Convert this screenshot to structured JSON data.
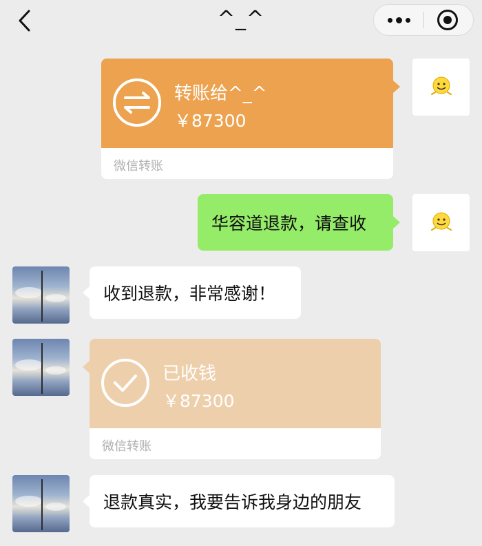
{
  "header": {
    "title": "^_^"
  },
  "colors": {
    "background": "#ececec",
    "transfer_sent": "#eda24f",
    "transfer_received": "#eecfac",
    "bubble_self": "#95ec69",
    "bubble_friend": "#ffffff"
  },
  "messages": [
    {
      "type": "transfer",
      "direction": "sent",
      "title": "转账给^_^",
      "amount": "￥87300",
      "footer": "微信转账",
      "icon": "transfer-arrows-icon"
    },
    {
      "type": "text",
      "direction": "sent",
      "text": "华容道退款，请查收"
    },
    {
      "type": "text",
      "direction": "received",
      "text": "收到退款，非常感谢！"
    },
    {
      "type": "transfer",
      "direction": "received",
      "title": "已收钱",
      "amount": "￥87300",
      "footer": "微信转账",
      "icon": "checkmark-icon"
    },
    {
      "type": "text",
      "direction": "received",
      "text": "退款真实，我要告诉我身边的朋友"
    }
  ],
  "avatars": {
    "self": "smiley-emoji-avatar",
    "friend": "sky-clouds-avatar"
  }
}
